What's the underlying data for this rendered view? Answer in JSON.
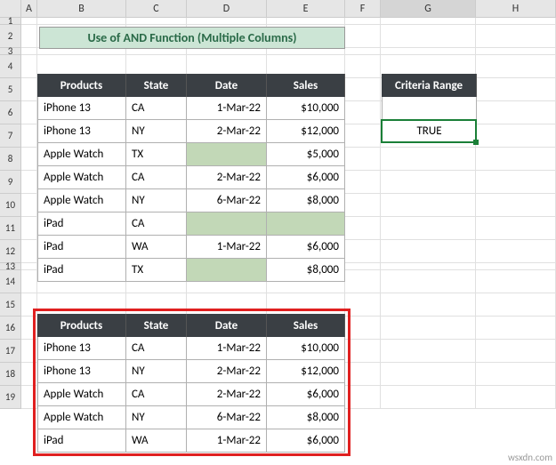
{
  "cols": [
    "A",
    "B",
    "C",
    "D",
    "E",
    "F",
    "G",
    "H"
  ],
  "rows": [
    "1",
    "2",
    "3",
    "4",
    "5",
    "6",
    "7",
    "8",
    "9",
    "10",
    "11",
    "12",
    "13",
    "14",
    "15",
    "16",
    "17",
    "18",
    "19"
  ],
  "selected_col": "G",
  "title": "Use of AND Function (Multiple Columns)",
  "headers": {
    "products": "Products",
    "state": "State",
    "date": "Date",
    "sales": "Sales"
  },
  "table1": [
    {
      "product": "iPhone 13",
      "state": "CA",
      "date": "1-Mar-22",
      "sales": "$10,000"
    },
    {
      "product": "iPhone 13",
      "state": "NY",
      "date": "2-Mar-22",
      "sales": "$12,000"
    },
    {
      "product": "Apple Watch",
      "state": "TX",
      "date": "",
      "sales": "$5,000",
      "empty_date": true
    },
    {
      "product": "Apple Watch",
      "state": "CA",
      "date": "2-Mar-22",
      "sales": "$6,000"
    },
    {
      "product": "Apple Watch",
      "state": "NY",
      "date": "6-Mar-22",
      "sales": "$8,000"
    },
    {
      "product": "iPad",
      "state": "CA",
      "date": "",
      "sales": "",
      "empty_date": true,
      "empty_sales": true
    },
    {
      "product": "iPad",
      "state": "WA",
      "date": "1-Mar-22",
      "sales": "$6,000"
    },
    {
      "product": "iPad",
      "state": "TX",
      "date": "",
      "sales": "$8,000",
      "empty_date": true
    }
  ],
  "table2": [
    {
      "product": "iPhone 13",
      "state": "CA",
      "date": "1-Mar-22",
      "sales": "$10,000"
    },
    {
      "product": "iPhone 13",
      "state": "NY",
      "date": "2-Mar-22",
      "sales": "$12,000"
    },
    {
      "product": "Apple Watch",
      "state": "CA",
      "date": "2-Mar-22",
      "sales": "$6,000"
    },
    {
      "product": "Apple Watch",
      "state": "NY",
      "date": "6-Mar-22",
      "sales": "$8,000"
    },
    {
      "product": "iPad",
      "state": "WA",
      "date": "1-Mar-22",
      "sales": "$6,000"
    }
  ],
  "criteria": {
    "header": "Criteria Range",
    "value": "TRUE"
  },
  "watermark": "wsxdn.com"
}
